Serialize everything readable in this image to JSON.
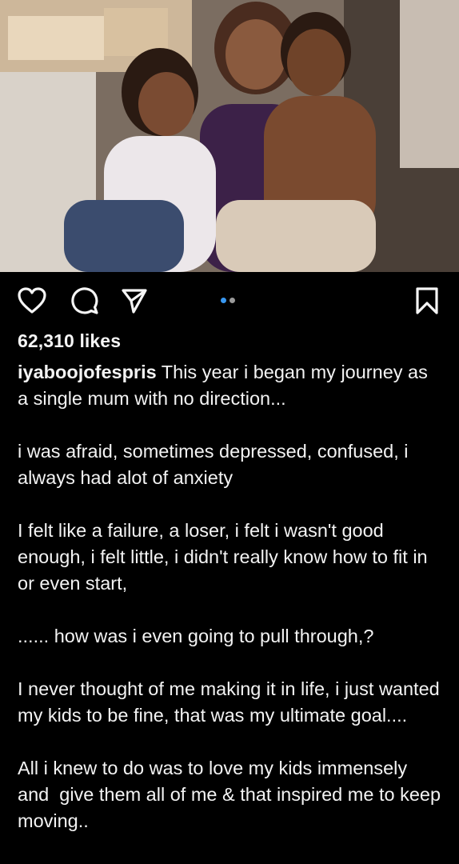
{
  "post": {
    "photo_alt": "photo",
    "likes": "62,310 likes",
    "username": "iyaboojofespris",
    "caption_first": " This year i began my journey as a single mum with no direction...",
    "paragraphs": [
      "i was afraid, sometimes depressed, confused, i always had alot of anxiety",
      "I felt like a failure, a loser, i felt i wasn't good enough, i felt little, i didn't really know how to fit in or even start,",
      "...... how was i even going to pull through,?",
      "I never thought of me making it in life, i just wanted my kids to be fine, that was my ultimate goal....",
      "All i knew to do was to love my kids immensely and  give them all of me & that inspired me to keep moving.."
    ]
  },
  "actions": {
    "like_icon": "heart-outline-icon",
    "comment_icon": "comment-bubble-icon",
    "share_icon": "paper-plane-icon",
    "save_icon": "bookmark-outline-icon"
  },
  "carousel": {
    "total": 2,
    "active_index": 0
  },
  "colors": {
    "background": "#000000",
    "text": "#f5f5f5",
    "active_dot": "#3897f0",
    "inactive_dot": "#9a9a9a"
  }
}
